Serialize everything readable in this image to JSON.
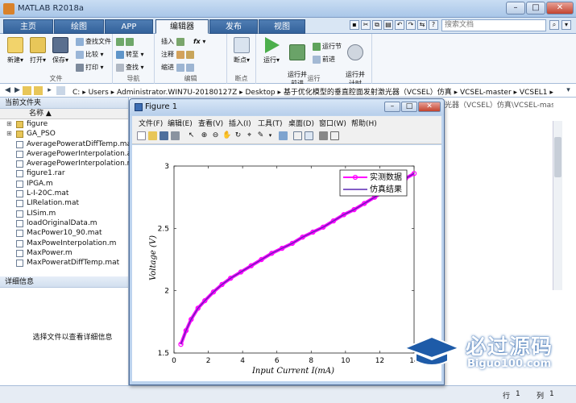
{
  "window": {
    "title": "MATLAB R2018a"
  },
  "tabs": [
    "主页",
    "绘图",
    "APP",
    "编辑器",
    "发布",
    "视图"
  ],
  "active_tab": "编辑器",
  "search": {
    "placeholder": "搜索文档"
  },
  "ribbon": {
    "file": {
      "label": "文件",
      "new": "新建",
      "open": "打开",
      "save": "保存",
      "find_files": "查找文件",
      "compare": "比较",
      "print": "打印"
    },
    "navigate": {
      "label": "导航",
      "goto": "转至",
      "find": "查找"
    },
    "edit": {
      "label": "编辑",
      "insert": "插入",
      "comment": "注释",
      "indent": "缩进",
      "fx": "fx"
    },
    "breakpoints": {
      "label": "断点",
      "btn": "断点"
    },
    "run": {
      "label": "运行",
      "run": "运行",
      "run_advance": "运行并\n前进",
      "run_section": "运行节",
      "advance": "前进",
      "run_time": "运行并\n计时"
    }
  },
  "address": {
    "segments": [
      "C:",
      "Users",
      "Administrator.WIN7U-20180127Z",
      "Desktop",
      "基于优化模型的垂直腔面发射激光器（VCSEL）仿真",
      "VCSEL-master",
      "VCSEL1"
    ]
  },
  "current_folder": {
    "header": "当前文件夹",
    "name_col": "名称 ▲",
    "files": [
      {
        "name": "figure",
        "folder": true
      },
      {
        "name": "GA_PSO",
        "folder": true
      },
      {
        "name": "AveragePoweratDiffTemp.mat",
        "folder": false
      },
      {
        "name": "AveragePowerInterpolation.asv",
        "folder": false
      },
      {
        "name": "AveragePowerInterpolation.m",
        "folder": false
      },
      {
        "name": "figure1.rar",
        "folder": false
      },
      {
        "name": "IPGA.m",
        "folder": false
      },
      {
        "name": "L-I-20C.mat",
        "folder": false
      },
      {
        "name": "LIRelation.mat",
        "folder": false
      },
      {
        "name": "LISim.m",
        "folder": false
      },
      {
        "name": "loadOriginalData.m",
        "folder": false
      },
      {
        "name": "MacPower10_90.mat",
        "folder": false
      },
      {
        "name": "MaxPoweInterpolation.m",
        "folder": false
      },
      {
        "name": "MaxPower.m",
        "folder": false
      },
      {
        "name": "MaxPoweratDiffTemp.mat",
        "folder": false
      }
    ]
  },
  "details": {
    "header": "详细信息",
    "message": "选择文件以查看详细信息"
  },
  "background_path": "光器（VCSEL）仿真\\VCSEL-mast...",
  "status": {
    "row_label": "行",
    "row": "1",
    "col_label": "列",
    "col": "1"
  },
  "figure": {
    "title": "Figure 1",
    "menu": [
      "文件(F)",
      "编辑(E)",
      "查看(V)",
      "插入(I)",
      "工具(T)",
      "桌面(D)",
      "窗口(W)",
      "帮助(H)"
    ]
  },
  "chart_data": {
    "type": "line",
    "xlabel": "Input Current I(mA)",
    "ylabel": "Voltage (V)",
    "xlim": [
      0,
      14
    ],
    "ylim": [
      1.5,
      3
    ],
    "xticks": [
      0,
      2,
      4,
      6,
      8,
      10,
      12,
      14
    ],
    "yticks": [
      1.5,
      2,
      2.5,
      3
    ],
    "grid": false,
    "legend": "top-right",
    "series": [
      {
        "name": "实测数据",
        "color": "#ff00ff",
        "marker": "circle",
        "x": [
          0.4,
          0.7,
          1.0,
          1.4,
          1.8,
          2.3,
          2.8,
          3.3,
          3.9,
          4.5,
          5.1,
          5.7,
          6.3,
          6.9,
          7.5,
          8.1,
          8.7,
          9.3,
          9.9,
          10.5,
          11.1,
          11.7,
          12.3,
          12.9,
          13.5,
          14.0
        ],
        "y": [
          1.57,
          1.68,
          1.77,
          1.86,
          1.92,
          1.99,
          2.05,
          2.1,
          2.15,
          2.2,
          2.25,
          2.3,
          2.34,
          2.38,
          2.43,
          2.47,
          2.51,
          2.56,
          2.61,
          2.65,
          2.7,
          2.75,
          2.8,
          2.85,
          2.9,
          2.94
        ]
      },
      {
        "name": "仿真结果",
        "color": "#5a28b4",
        "marker": "none",
        "x": [
          0.4,
          0.7,
          1.0,
          1.4,
          1.8,
          2.3,
          2.8,
          3.3,
          3.9,
          4.5,
          5.1,
          5.7,
          6.3,
          6.9,
          7.5,
          8.1,
          8.7,
          9.3,
          9.9,
          10.5,
          11.1,
          11.7,
          12.3,
          12.9,
          13.5,
          14.0
        ],
        "y": [
          1.57,
          1.68,
          1.77,
          1.86,
          1.92,
          1.99,
          2.05,
          2.1,
          2.15,
          2.2,
          2.25,
          2.3,
          2.34,
          2.38,
          2.43,
          2.47,
          2.51,
          2.56,
          2.61,
          2.65,
          2.7,
          2.75,
          2.8,
          2.85,
          2.9,
          2.94
        ]
      }
    ]
  },
  "watermark": {
    "brand": "必过源码",
    "url": "Biguo100.com"
  }
}
